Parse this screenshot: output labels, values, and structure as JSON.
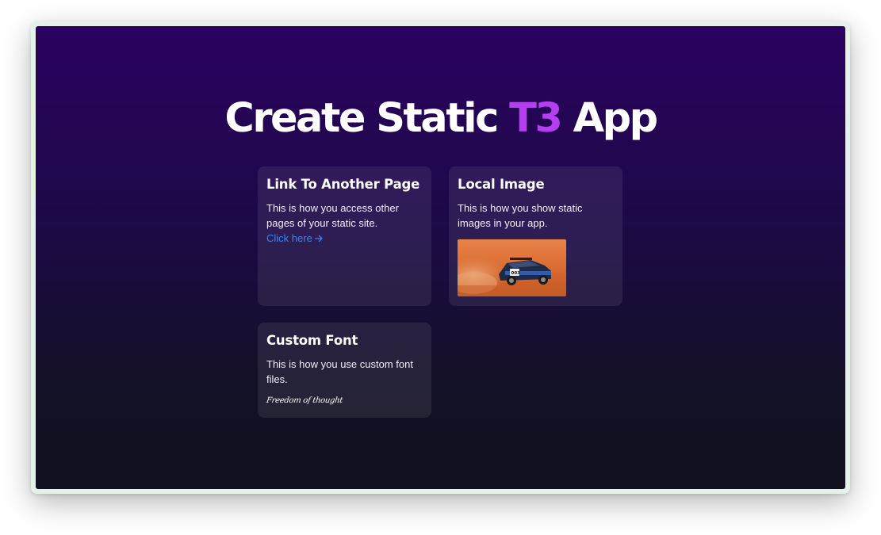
{
  "hero": {
    "title_part1": "Create Static ",
    "title_accent": "T3",
    "title_part2": " App",
    "accent_color": "#b43ef0"
  },
  "cards": [
    {
      "title": "Link To Another Page",
      "body": "This is how you access other pages of your static site.",
      "link_label": "Click here",
      "link_icon": "arrow-right-icon",
      "link_color": "#3b82f6"
    },
    {
      "title": "Local Image",
      "body": "This is how you show static images in your app.",
      "image_subject": "rally-car-in-desert-photo"
    },
    {
      "title": "Custom Font",
      "body": "This is how you use custom font files.",
      "font_sample": "Freedom of thought"
    }
  ],
  "colors": {
    "background_top": "#2b0160",
    "background_bottom": "#111120",
    "card_background": "rgba(255,255,255,0.08)"
  }
}
